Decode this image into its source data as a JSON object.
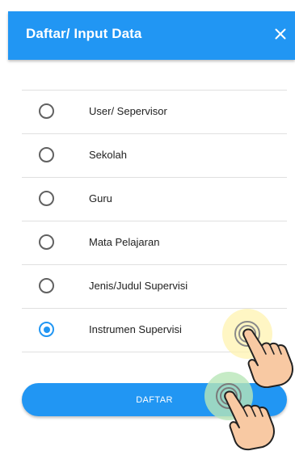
{
  "header": {
    "title": "Daftar/ Input Data",
    "close_icon": "close-icon",
    "background": "#2196f3"
  },
  "options": [
    {
      "label": "User/ Sepervisor",
      "selected": false
    },
    {
      "label": "Sekolah",
      "selected": false
    },
    {
      "label": "Guru",
      "selected": false
    },
    {
      "label": "Mata Pelajaran",
      "selected": false
    },
    {
      "label": "Jenis/Judul Supervisi",
      "selected": false
    },
    {
      "label": "Instrumen Supervisi",
      "selected": true
    }
  ],
  "submit": {
    "label": "DAFTAR",
    "background": "#2196f3"
  },
  "accent_color": "#2196f3",
  "overlays": [
    "tap-hand-icon",
    "tap-hand-icon"
  ]
}
